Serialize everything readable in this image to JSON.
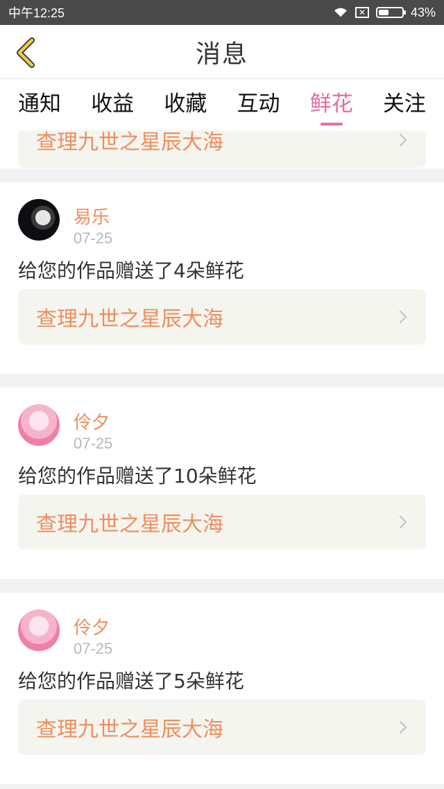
{
  "status_bar": {
    "time": "中午12:25",
    "battery": "43%",
    "battery_level": 0.43,
    "sim_icon": "sim-missing-icon",
    "wifi_icon": "wifi-icon"
  },
  "header": {
    "title": "消息",
    "back_icon": "back-chevron-icon"
  },
  "tabs": [
    {
      "label": "通知"
    },
    {
      "label": "收益"
    },
    {
      "label": "收藏"
    },
    {
      "label": "互动"
    },
    {
      "label": "鲜花",
      "active": true
    },
    {
      "label": "关注"
    }
  ],
  "partial_item": {
    "work_title": "查理九世之星辰大海"
  },
  "items": [
    {
      "username": "易乐",
      "date": "07-25",
      "message": "给您的作品赠送了4朵鲜花",
      "work_title": "查理九世之星辰大海"
    },
    {
      "username": "伶夕",
      "date": "07-25",
      "message": "给您的作品赠送了10朵鲜花",
      "work_title": "查理九世之星辰大海"
    },
    {
      "username": "伶夕",
      "date": "07-25",
      "message": "给您的作品赠送了5朵鲜花",
      "work_title": "查理九世之星辰大海"
    }
  ],
  "colors": {
    "accent": "#e66ba5",
    "highlight": "#ee8e5c",
    "back_icon": "#f2c94c"
  }
}
